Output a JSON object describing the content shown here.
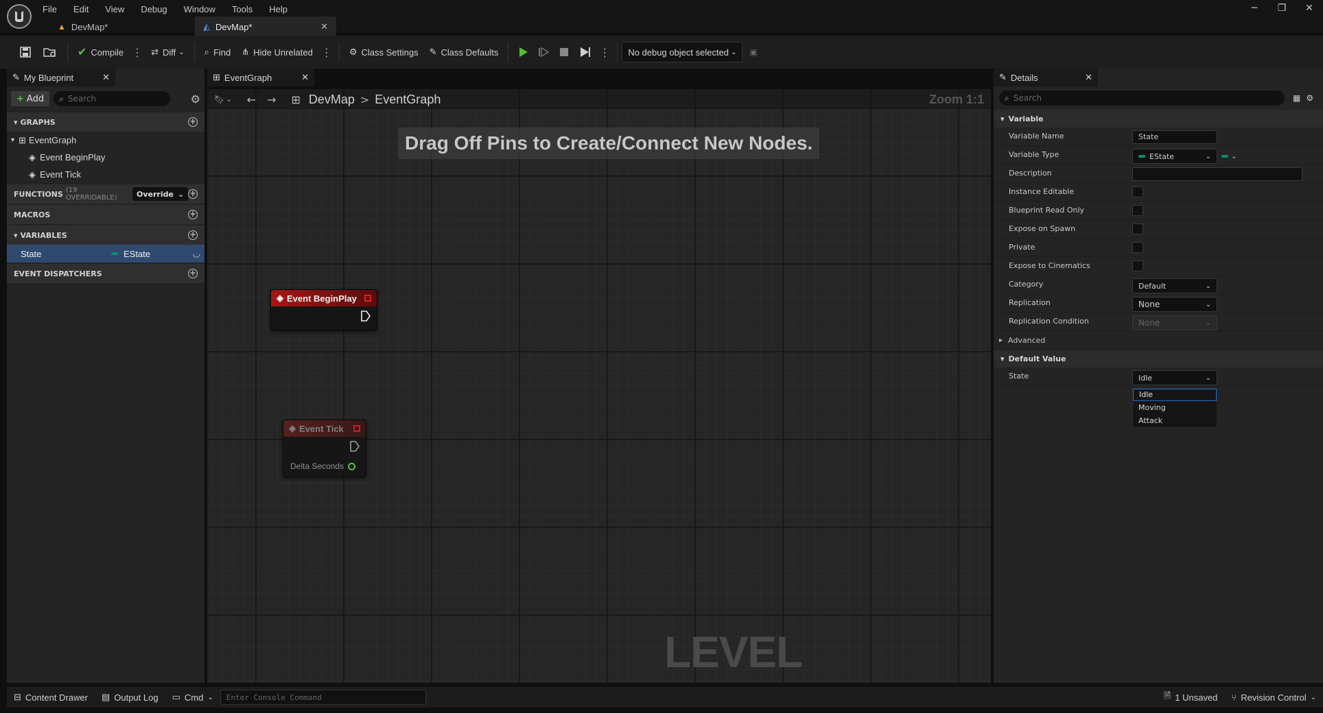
{
  "menu": [
    "File",
    "Edit",
    "View",
    "Debug",
    "Window",
    "Tools",
    "Help"
  ],
  "tabs": [
    {
      "label": "DevMap*",
      "active": false
    },
    {
      "label": "DevMap*",
      "active": true
    }
  ],
  "toolbar": {
    "compile": "Compile",
    "diff": "Diff",
    "find": "Find",
    "hide_unrelated": "Hide Unrelated",
    "class_settings": "Class Settings",
    "class_defaults": "Class Defaults",
    "debug_object": "No debug object selected"
  },
  "my_blueprint": {
    "tab_title": "My Blueprint",
    "add_label": "Add",
    "search_placeholder": "Search",
    "graphs_header": "GRAPHS",
    "event_graph": "EventGraph",
    "event_beginplay": "Event BeginPlay",
    "event_tick": "Event Tick",
    "functions_header": "FUNCTIONS",
    "functions_count": "(19 OVERRIDABLE)",
    "override_label": "Override",
    "macros_header": "MACROS",
    "variables_header": "VARIABLES",
    "variable_name": "State",
    "variable_type": "EState",
    "dispatchers_header": "EVENT DISPATCHERS"
  },
  "graph": {
    "tab_title": "EventGraph",
    "breadcrumb_root": "DevMap",
    "breadcrumb_sep": ">",
    "breadcrumb_current": "EventGraph",
    "zoom": "Zoom 1:1",
    "hint": "Drag Off Pins to Create/Connect New Nodes.",
    "watermark": "LEVEL BLUEPRINT",
    "node_beginplay": "Event BeginPlay",
    "node_tick": "Event Tick",
    "delta_seconds": "Delta Seconds"
  },
  "details": {
    "tab_title": "Details",
    "search_placeholder": "Search",
    "variable_section": "Variable",
    "rows": {
      "variable_name_label": "Variable Name",
      "variable_name_value": "State",
      "variable_type_label": "Variable Type",
      "variable_type_value": "EState",
      "description_label": "Description",
      "instance_editable_label": "Instance Editable",
      "read_only_label": "Blueprint Read Only",
      "expose_spawn_label": "Expose on Spawn",
      "private_label": "Private",
      "expose_cinematics_label": "Expose to Cinematics",
      "category_label": "Category",
      "category_value": "Default",
      "replication_label": "Replication",
      "replication_value": "None",
      "replication_condition_label": "Replication Condition",
      "replication_condition_value": "None"
    },
    "advanced_label": "Advanced",
    "default_value_section": "Default Value",
    "state_label": "State",
    "state_value": "Idle",
    "state_options": [
      "Idle",
      "Moving",
      "Attack"
    ]
  },
  "statusbar": {
    "content_drawer": "Content Drawer",
    "output_log": "Output Log",
    "cmd": "Cmd",
    "console_placeholder": "Enter Console Command",
    "unsaved": "1 Unsaved",
    "revision_control": "Revision Control"
  },
  "colors": {
    "event_node_header": "#9b1414",
    "selection": "#2f4a6e",
    "play_green": "#4fc12f",
    "enum_teal": "#0b8a73",
    "dropdown_highlight": "#1f6fd0"
  }
}
